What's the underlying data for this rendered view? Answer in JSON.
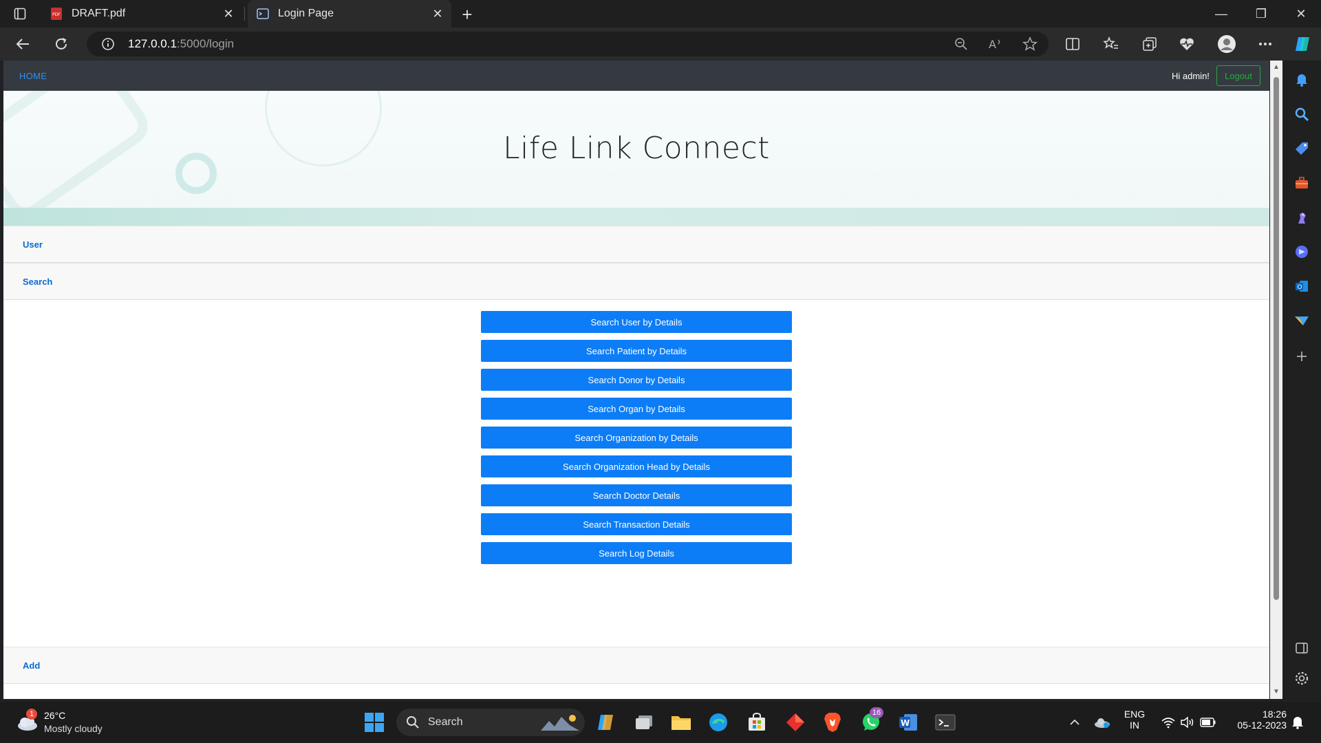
{
  "browser": {
    "tabs": [
      {
        "title": "DRAFT.pdf",
        "icon": "pdf-icon"
      },
      {
        "title": "Login Page",
        "icon": "page-icon"
      }
    ],
    "address": {
      "host": "127.0.0.1",
      "path": ":5000/login"
    }
  },
  "site": {
    "nav": {
      "home": "HOME",
      "greeting": "Hi admin!",
      "logout": "Logout"
    },
    "title": "Life Link Connect",
    "sections": {
      "user": "User",
      "search": "Search",
      "add": "Add"
    },
    "search_buttons": [
      "Search User by Details",
      "Search Patient by Details",
      "Search Donor by Details",
      "Search Organ by Details",
      "Search Organization by Details",
      "Search Organization Head by Details",
      "Search Doctor Details",
      "Search Transaction Details",
      "Search Log Details"
    ]
  },
  "taskbar": {
    "weather": {
      "temp": "26°C",
      "condition": "Mostly cloudy",
      "badge": "1"
    },
    "search_label": "Search",
    "whatsapp_badge": "16",
    "lang": {
      "line1": "ENG",
      "line2": "IN"
    },
    "clock": {
      "time": "18:26",
      "date": "05-12-2023"
    }
  },
  "colors": {
    "accent": "#0d7df7",
    "nav_bg": "#343a40",
    "logout": "#28a745"
  }
}
